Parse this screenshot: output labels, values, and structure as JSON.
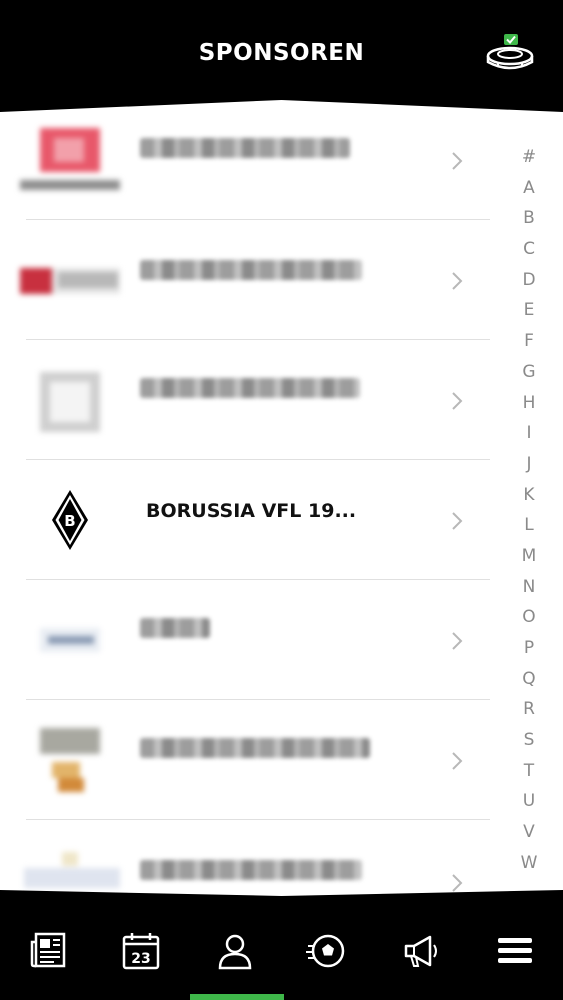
{
  "header": {
    "title": "SPONSOREN",
    "stadium_icon": "stadium-check-icon"
  },
  "sponsors": [
    {
      "name": "",
      "logo": "blurred-red-logo",
      "redacted": true
    },
    {
      "name": "",
      "logo": "blurred-red-banner-logo",
      "redacted": true
    },
    {
      "name": "",
      "logo": "blurred-gray-logo",
      "redacted": true
    },
    {
      "name": "BORUSSIA VFL 19...",
      "logo": "borussia-crest-icon",
      "redacted": false
    },
    {
      "name": "",
      "logo": "blurred-blue-logo",
      "redacted": true
    },
    {
      "name": "",
      "logo": "blurred-orange-logo",
      "redacted": true
    },
    {
      "name": "",
      "logo": "blurred-light-logo",
      "redacted": true
    }
  ],
  "index_letters": [
    "#",
    "A",
    "B",
    "C",
    "D",
    "E",
    "F",
    "G",
    "H",
    "I",
    "J",
    "K",
    "L",
    "M",
    "N",
    "O",
    "P",
    "Q",
    "R",
    "S",
    "T",
    "U",
    "V",
    "W"
  ],
  "tabs": [
    {
      "name": "news",
      "icon": "newspaper-icon"
    },
    {
      "name": "calendar",
      "icon": "calendar-icon",
      "label": "23"
    },
    {
      "name": "profile",
      "icon": "person-icon",
      "active": true
    },
    {
      "name": "match",
      "icon": "football-icon"
    },
    {
      "name": "announcements",
      "icon": "megaphone-icon"
    },
    {
      "name": "menu",
      "icon": "hamburger-menu-icon"
    }
  ],
  "colors": {
    "accent": "#3fb84a",
    "header_bg": "#000000",
    "list_bg": "#ffffff"
  }
}
